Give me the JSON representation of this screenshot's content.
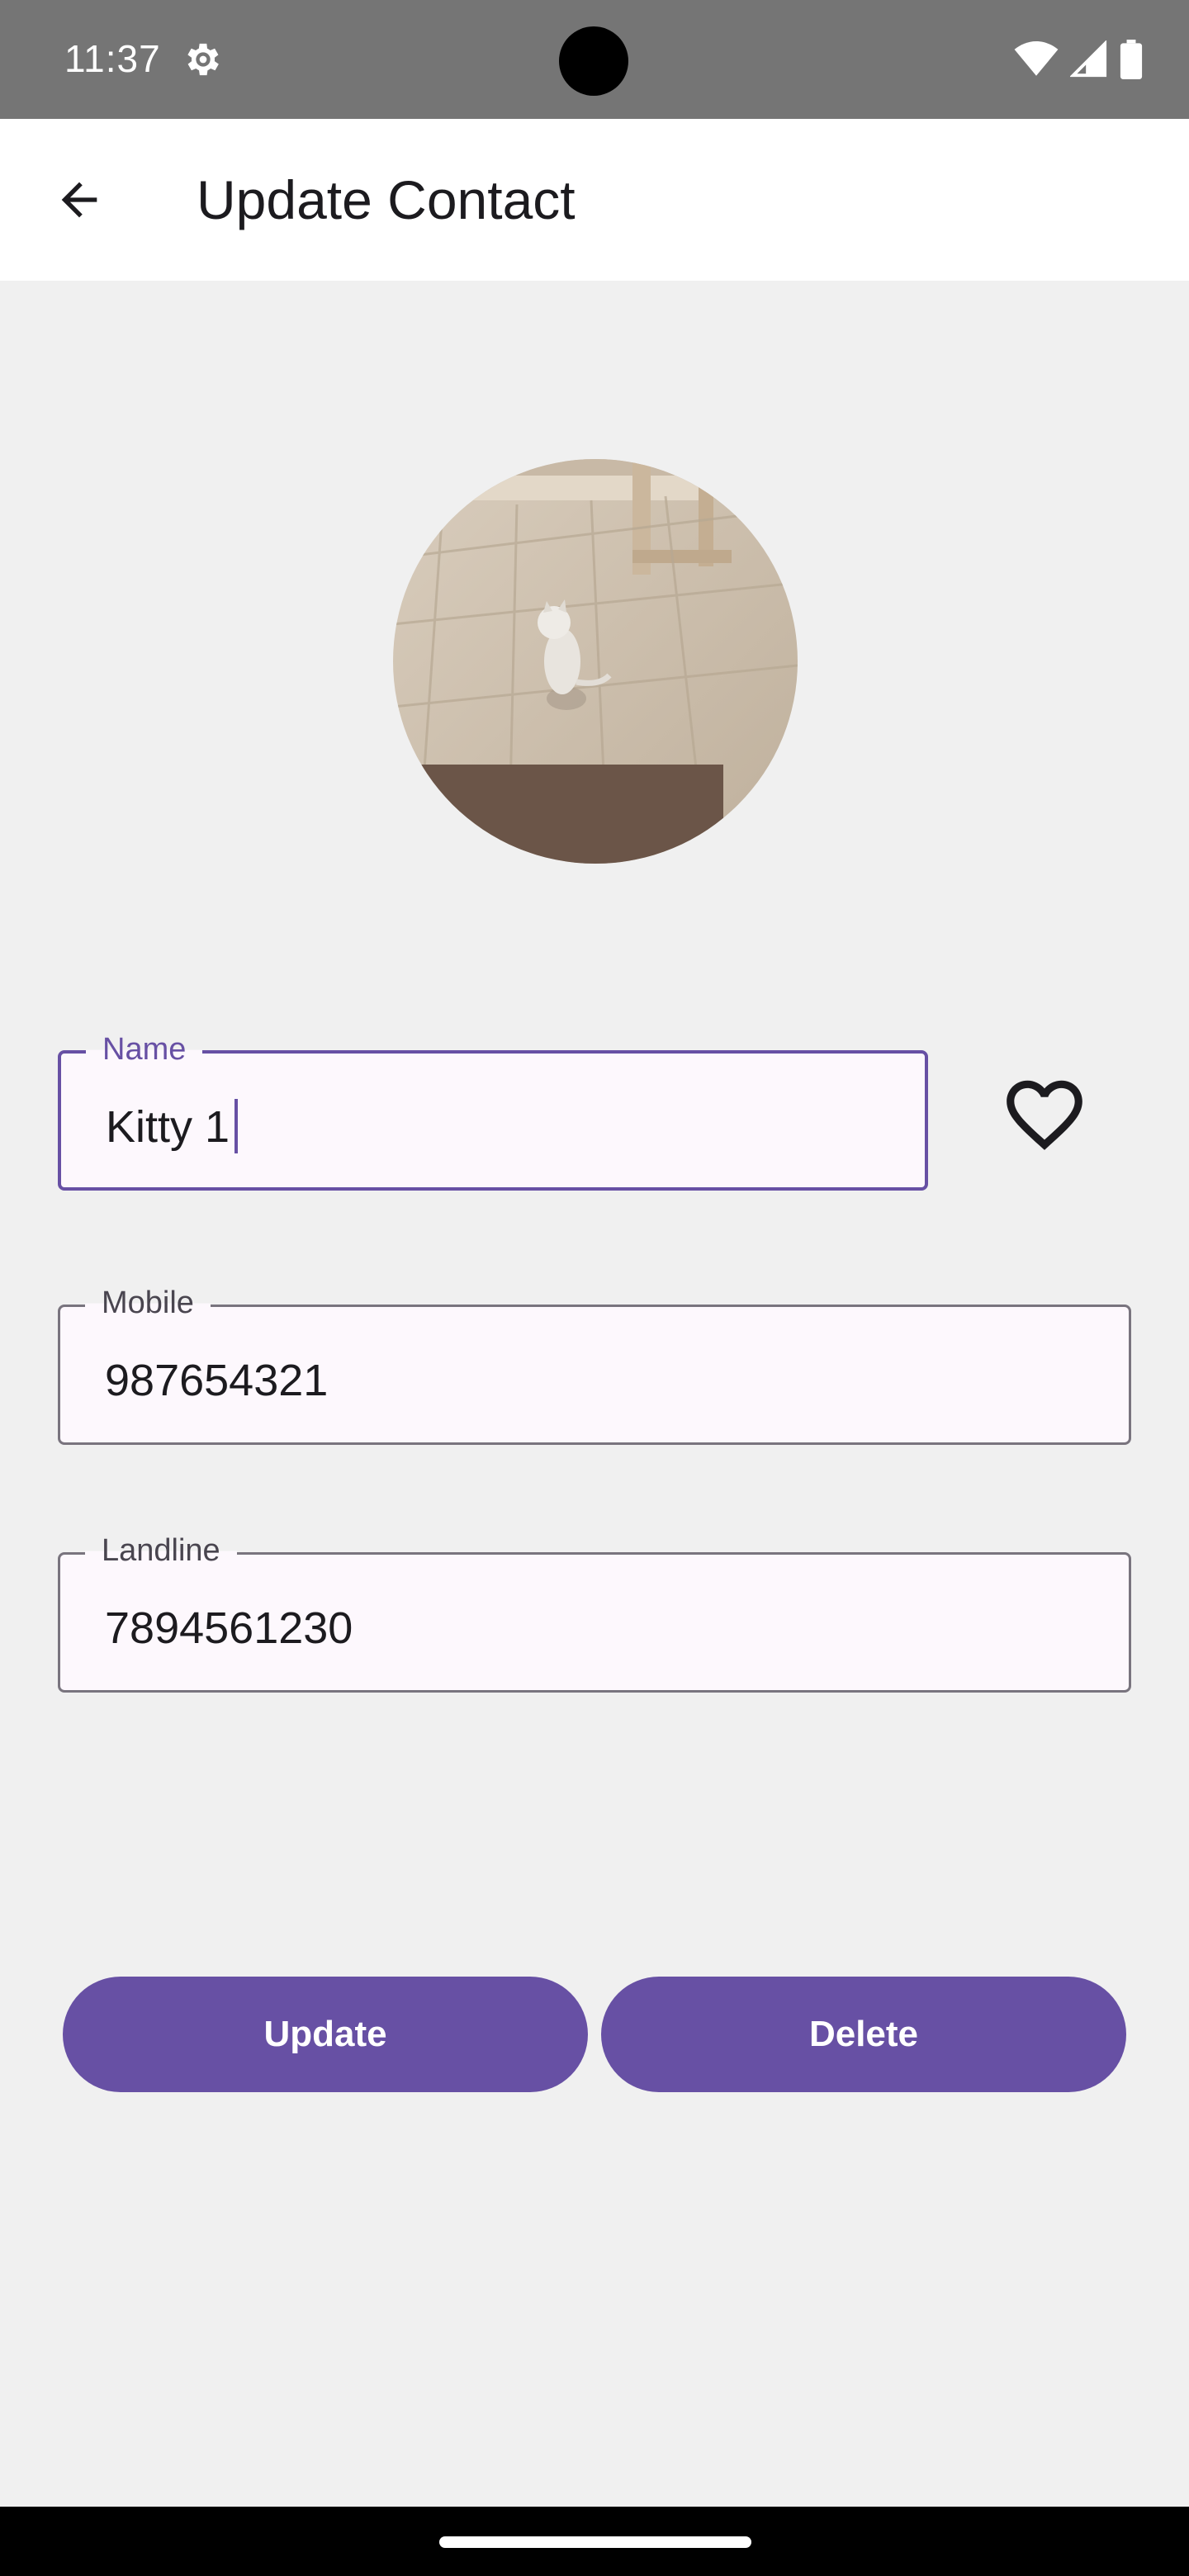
{
  "status_bar": {
    "time": "11:37",
    "icons": [
      "settings-gear-icon",
      "wifi-icon",
      "cellular-signal-icon",
      "battery-icon"
    ]
  },
  "app_bar": {
    "title": "Update Contact",
    "back_icon": "arrow-back-icon"
  },
  "avatar": {
    "description_icon": "contact-photo"
  },
  "form": {
    "name": {
      "label": "Name",
      "value": "Kitty 1"
    },
    "mobile": {
      "label": "Mobile",
      "value": "987654321"
    },
    "landline": {
      "label": "Landline",
      "value": "7894561230"
    },
    "favorite_icon": "heart-outline-icon"
  },
  "actions": {
    "update_label": "Update",
    "delete_label": "Delete"
  },
  "colors": {
    "accent": "#6750a4",
    "status_bar": "#757575",
    "background": "#f0f0f0"
  }
}
